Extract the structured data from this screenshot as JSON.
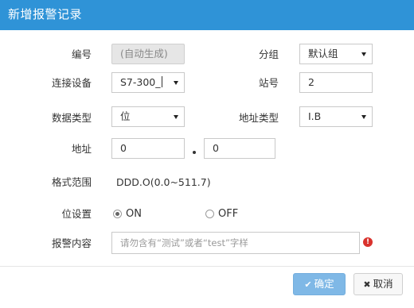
{
  "dialog": {
    "title": "新增报警记录"
  },
  "form": {
    "id": {
      "label": "编号",
      "value": "(自动生成)"
    },
    "group": {
      "label": "分组",
      "value": "默认组"
    },
    "device": {
      "label": "连接设备",
      "value": "S7-300_"
    },
    "station": {
      "label": "站号",
      "value": "2"
    },
    "data_type": {
      "label": "数据类型",
      "value": "位"
    },
    "address_type": {
      "label": "地址类型",
      "value": "I.B"
    },
    "address": {
      "label": "地址",
      "value1": "0",
      "value2": "0"
    },
    "format_range": {
      "label": "格式范围",
      "value": "DDD.O(0.0~511.7)"
    },
    "bit_setting": {
      "label": "位设置",
      "options": [
        {
          "label": "ON",
          "selected": true
        },
        {
          "label": "OFF",
          "selected": false
        }
      ]
    },
    "alarm_content": {
      "label": "报警内容",
      "placeholder": "请勿含有“测试”或者“test”字样",
      "error_icon": "exclamation-icon"
    }
  },
  "buttons": {
    "ok": {
      "icon": "check-icon",
      "glyph": "✔",
      "label": "确定"
    },
    "cancel": {
      "icon": "times-icon",
      "glyph": "✖",
      "label": "取消"
    }
  },
  "colors": {
    "titlebar": "#2f93d7",
    "ok_button": "#7fb8e6",
    "error": "#d9322d"
  }
}
